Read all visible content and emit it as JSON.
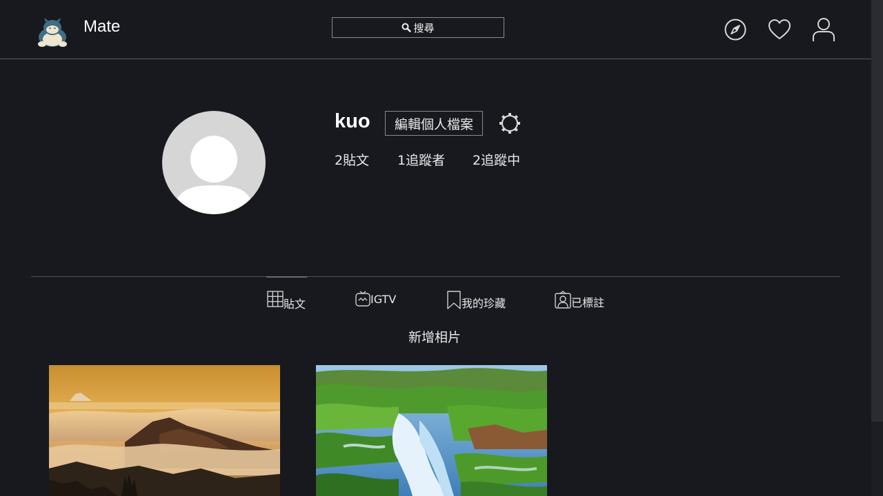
{
  "header": {
    "brand": "Mate",
    "search_label": "搜尋"
  },
  "profile": {
    "username": "kuo",
    "edit_label": "編輯個人檔案",
    "stats": {
      "posts": "2貼文",
      "followers": "1追蹤者",
      "following": "2追蹤中"
    }
  },
  "tabs": {
    "posts": "貼文",
    "igtv": "IGTV",
    "saved": "我的珍藏",
    "tagged": "已標註"
  },
  "add_photo": "新增相片",
  "colors": {
    "background": "#18191e",
    "border": "#5a5b60",
    "text": "#e8e8e8"
  }
}
